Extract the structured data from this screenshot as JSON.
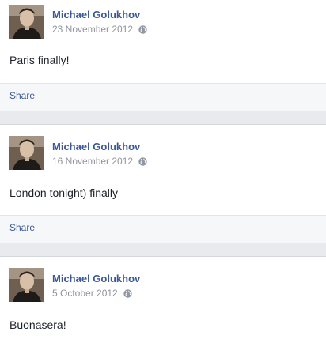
{
  "posts": [
    {
      "author": "Michael Golukhov",
      "date": "23 November 2012",
      "privacy_icon": "globe-icon",
      "message": "Paris finally!",
      "share_label": "Share"
    },
    {
      "author": "Michael Golukhov",
      "date": "16 November 2012",
      "privacy_icon": "globe-icon",
      "message": "London tonight) finally",
      "share_label": "Share"
    },
    {
      "author": "Michael Golukhov",
      "date": "5 October 2012",
      "privacy_icon": "globe-icon",
      "message": "Buonasera!"
    }
  ],
  "colors": {
    "link": "#3b5998",
    "meta": "#90949c",
    "text": "#1d2129",
    "background": "#e9eaed"
  }
}
